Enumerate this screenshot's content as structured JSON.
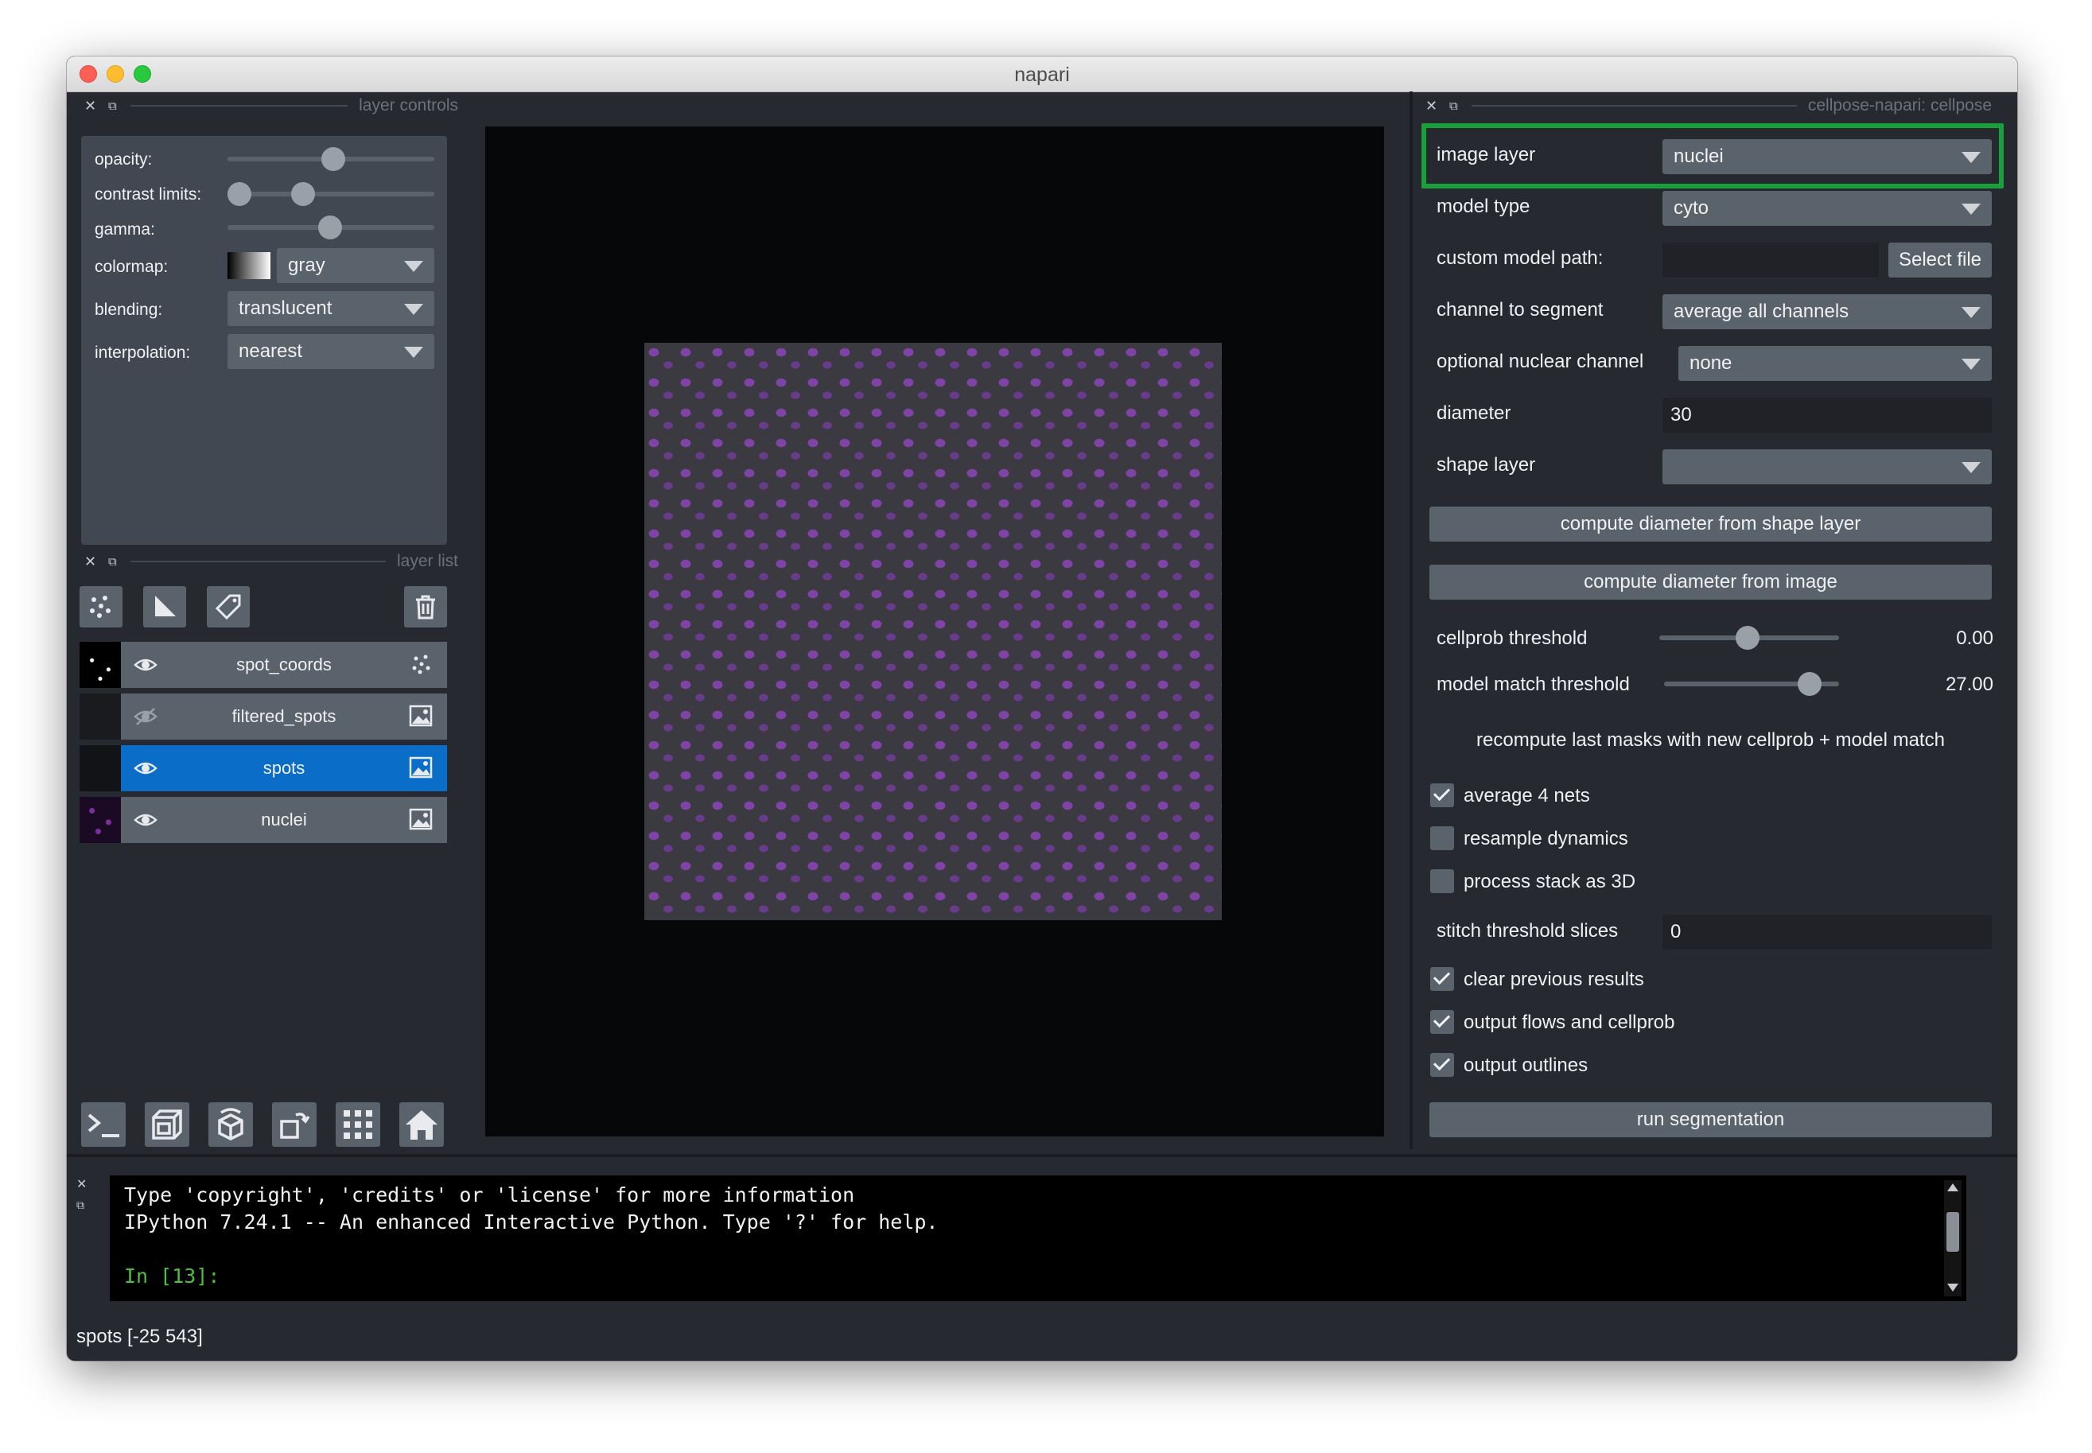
{
  "window": {
    "title": "napari"
  },
  "layer_controls": {
    "dock_title": "layer controls",
    "opacity_label": "opacity:",
    "contrast_label": "contrast limits:",
    "gamma_label": "gamma:",
    "colormap_label": "colormap:",
    "colormap_value": "gray",
    "blending_label": "blending:",
    "blending_value": "translucent",
    "interpolation_label": "interpolation:",
    "interpolation_value": "nearest"
  },
  "layer_list": {
    "dock_title": "layer list",
    "layers": [
      {
        "name": "spot_coords",
        "visible": true,
        "selected": false,
        "type_icon": "points-icon"
      },
      {
        "name": "filtered_spots",
        "visible": false,
        "selected": false,
        "type_icon": "image-icon"
      },
      {
        "name": "spots",
        "visible": true,
        "selected": true,
        "type_icon": "image-icon"
      },
      {
        "name": "nuclei",
        "visible": true,
        "selected": false,
        "type_icon": "image-icon"
      }
    ]
  },
  "bottom_buttons": [
    "console-icon",
    "ndisplay-icon",
    "roll-icon",
    "transpose-icon",
    "grid-icon",
    "home-icon"
  ],
  "cellpose": {
    "dock_title": "cellpose-napari: cellpose",
    "image_layer_label": "image layer",
    "image_layer_value": "nuclei",
    "model_type_label": "model type",
    "model_type_value": "cyto",
    "custom_model_label": "custom model path:",
    "custom_model_value": "",
    "select_file": "Select file",
    "channel_label": "channel to segment",
    "channel_value": "average all channels",
    "nuclear_label": "optional nuclear channel",
    "nuclear_value": "none",
    "diameter_label": "diameter",
    "diameter_value": "30",
    "shape_layer_label": "shape layer",
    "shape_layer_value": "",
    "btn_diam_shape": "compute diameter from shape layer",
    "btn_diam_image": "compute diameter from image",
    "cellprob_label": "cellprob threshold",
    "cellprob_value": "0.00",
    "cellprob_level": 0.49,
    "match_label": "model match threshold",
    "match_value": "27.00",
    "match_level": 0.83,
    "recompute": "recompute last masks with new cellprob + model match",
    "avg4": "average 4 nets",
    "resample": "resample dynamics",
    "stack3d": "process stack as 3D",
    "stitch_label": "stitch threshold slices",
    "stitch_value": "0",
    "clear_prev": "clear previous results",
    "output_flows": "output flows and cellprob",
    "output_outlines": "output outlines",
    "run": "run segmentation",
    "checks": {
      "avg4": true,
      "resample": false,
      "stack3d": false,
      "clear_prev": true,
      "output_flows": true,
      "output_outlines": true
    },
    "highlight_color": "#1aa03a"
  },
  "console": {
    "line1": "Type 'copyright', 'credits' or 'license' for more information",
    "line2": "IPython 7.24.1 -- An enhanced Interactive Python. Type '?' for help.",
    "prompt": "In [13]:"
  },
  "status_bar": {
    "text": "spots [-25 543]"
  }
}
